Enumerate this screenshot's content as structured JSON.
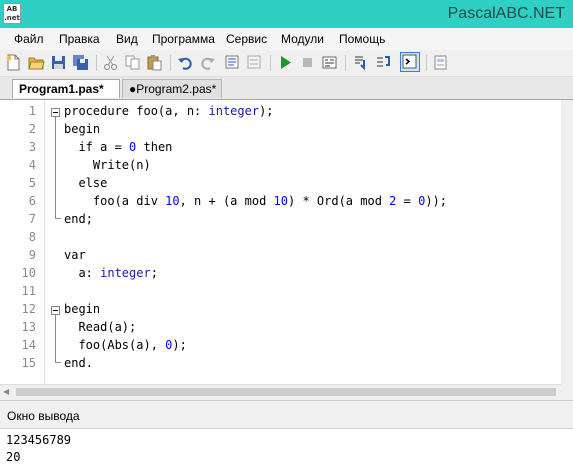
{
  "window": {
    "title": "PascalABC.NET",
    "icon_text": [
      "AB",
      ".net"
    ]
  },
  "menu": [
    "Файл",
    "Правка",
    "Вид",
    "Программа",
    "Сервис",
    "Модули",
    "Помощь"
  ],
  "toolbar": {
    "buttons": [
      "new-file-icon",
      "open-icon",
      "save-icon",
      "save-all-icon",
      "cut-icon",
      "copy-icon",
      "paste-icon",
      "undo-icon",
      "redo-icon",
      "find-icon",
      "find-replace-icon",
      "run-icon",
      "stop-icon",
      "compile-icon",
      "step-into-icon",
      "step-over-icon",
      "output-window-icon",
      "form-icon"
    ],
    "active_button": "output-window-icon"
  },
  "tabs": [
    {
      "label": "Program1.pas*",
      "active": true
    },
    {
      "label": "●Program2.pas*",
      "active": false
    }
  ],
  "editor": {
    "line_numbers": [
      "1",
      "2",
      "3",
      "4",
      "5",
      "6",
      "7",
      "8",
      "9",
      "10",
      "11",
      "12",
      "13",
      "14",
      "15"
    ],
    "lines": [
      [
        {
          "t": "procedure ",
          "c": "kw"
        },
        {
          "t": "foo(a, n: ",
          "c": "p"
        },
        {
          "t": "integer",
          "c": "ty"
        },
        {
          "t": ");",
          "c": "p"
        }
      ],
      [
        {
          "t": "begin",
          "c": "kw"
        }
      ],
      [
        {
          "t": "  ",
          "c": "p"
        },
        {
          "t": "if ",
          "c": "kw"
        },
        {
          "t": "a = ",
          "c": "p"
        },
        {
          "t": "0 ",
          "c": "num"
        },
        {
          "t": "then",
          "c": "kw"
        }
      ],
      [
        {
          "t": "    Write(n)",
          "c": "p"
        }
      ],
      [
        {
          "t": "  ",
          "c": "p"
        },
        {
          "t": "else",
          "c": "kw"
        }
      ],
      [
        {
          "t": "    foo(a ",
          "c": "p"
        },
        {
          "t": "div ",
          "c": "kw"
        },
        {
          "t": "10",
          "c": "num"
        },
        {
          "t": ", n + (a ",
          "c": "p"
        },
        {
          "t": "mod ",
          "c": "kw"
        },
        {
          "t": "10",
          "c": "num"
        },
        {
          "t": ") * Ord(a ",
          "c": "p"
        },
        {
          "t": "mod ",
          "c": "kw"
        },
        {
          "t": "2",
          "c": "num"
        },
        {
          "t": " = ",
          "c": "p"
        },
        {
          "t": "0",
          "c": "num"
        },
        {
          "t": "));",
          "c": "p"
        }
      ],
      [
        {
          "t": "end",
          "c": "kw"
        },
        {
          "t": ";",
          "c": "p"
        }
      ],
      [],
      [
        {
          "t": "var",
          "c": "kw"
        }
      ],
      [
        {
          "t": "  a: ",
          "c": "p"
        },
        {
          "t": "integer",
          "c": "ty"
        },
        {
          "t": ";",
          "c": "p"
        }
      ],
      [],
      [
        {
          "t": "begin",
          "c": "kw"
        }
      ],
      [
        {
          "t": "  Read(a);",
          "c": "p"
        }
      ],
      [
        {
          "t": "  foo(Abs(a), ",
          "c": "p"
        },
        {
          "t": "0",
          "c": "num"
        },
        {
          "t": ");",
          "c": "p"
        }
      ],
      [
        {
          "t": "end",
          "c": "kw"
        },
        {
          "t": ".",
          "c": "p"
        }
      ]
    ],
    "colors": {
      "kw": "#000000",
      "p": "#000000",
      "ty": "#1a1aa6",
      "num": "#0000ff"
    }
  },
  "output": {
    "header": "Окно вывода",
    "lines": [
      "123456789",
      "20"
    ]
  }
}
